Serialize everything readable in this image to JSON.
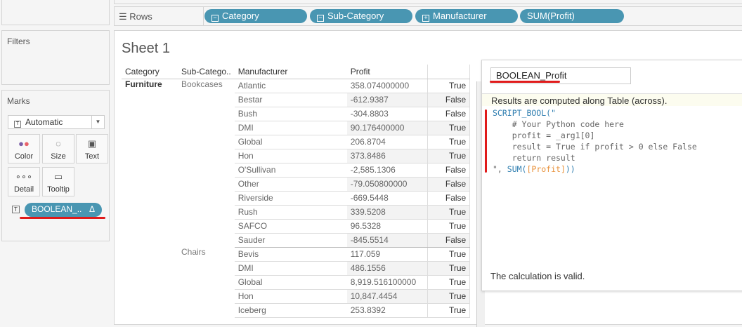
{
  "shelves": {
    "rows_label": "Rows",
    "pills": [
      "Category",
      "Sub-Category",
      "Manufacturer",
      "SUM(Profit)"
    ]
  },
  "filters": {
    "title": "Filters"
  },
  "marks": {
    "title": "Marks",
    "type": "Automatic",
    "buttons": [
      "Color",
      "Size",
      "Text",
      "Detail",
      "Tooltip"
    ],
    "field_pill": "BOOLEAN_.."
  },
  "sheet": {
    "title": "Sheet 1",
    "headers": [
      "Category",
      "Sub-Catego..",
      "Manufacturer",
      "Profit"
    ],
    "category": "Furniture",
    "groups": [
      {
        "sub": "Bookcases",
        "rows": [
          [
            "Atlantic",
            "358.074000000",
            "True"
          ],
          [
            "Bestar",
            "-612.9387",
            "False"
          ],
          [
            "Bush",
            "-304.8803",
            "False"
          ],
          [
            "DMI",
            "90.176400000",
            "True"
          ],
          [
            "Global",
            "206.8704",
            "True"
          ],
          [
            "Hon",
            "373.8486",
            "True"
          ],
          [
            "O'Sullivan",
            "-2,585.1306",
            "False"
          ],
          [
            "Other",
            "-79.050800000",
            "False"
          ],
          [
            "Riverside",
            "-669.5448",
            "False"
          ],
          [
            "Rush",
            "339.5208",
            "True"
          ],
          [
            "SAFCO",
            "96.5328",
            "True"
          ],
          [
            "Sauder",
            "-845.5514",
            "False"
          ]
        ]
      },
      {
        "sub": "Chairs",
        "rows": [
          [
            "Bevis",
            "117.059",
            "True"
          ],
          [
            "DMI",
            "486.1556",
            "True"
          ],
          [
            "Global",
            "8,919.516100000",
            "True"
          ],
          [
            "Hon",
            "10,847.4454",
            "True"
          ],
          [
            "Iceberg",
            "253.8392",
            "True"
          ]
        ]
      }
    ]
  },
  "calc": {
    "name": "BOOLEAN_Profit",
    "note": "Results are computed along Table (across).",
    "code": {
      "l1": "SCRIPT_BOOL(\"",
      "l2": "    # Your Python code here",
      "l3": "    profit = _arg1[0]",
      "l4": "    result = True if profit > 0 else False",
      "l5": "    return result",
      "l6a": "\", ",
      "l6fn": "SUM(",
      "l6fld": "[Profit]",
      "l6b": "))"
    },
    "status": "The calculation is valid."
  },
  "colors": {
    "pill": "#4996b2",
    "highlight": "#e01b1b"
  }
}
